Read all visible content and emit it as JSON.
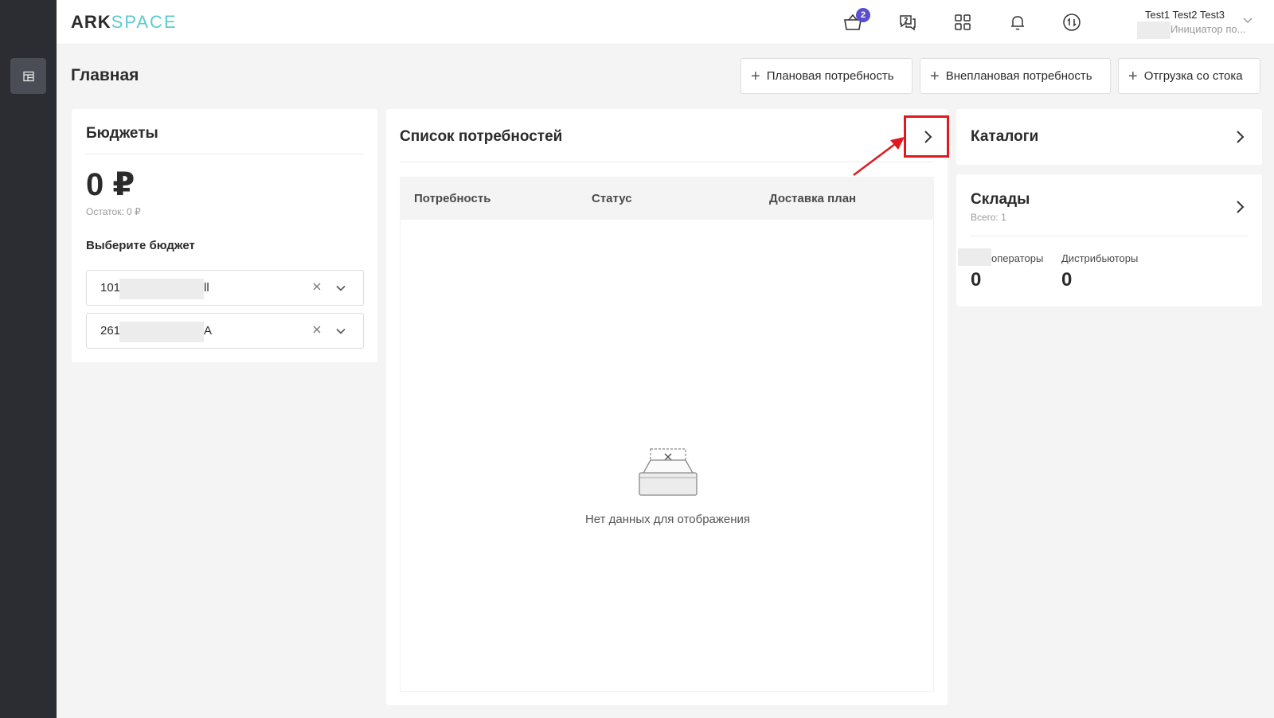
{
  "brand": {
    "logo_part1": "ARK",
    "logo_part2": "SPACE"
  },
  "header": {
    "cart_badge": "2",
    "user": {
      "name": "Test1 Test2 Test3",
      "role": "Инициатор по..."
    }
  },
  "page": {
    "title": "Главная"
  },
  "actions": [
    {
      "label": "Плановая потребность"
    },
    {
      "label": "Внеплановая потребность"
    },
    {
      "label": "Отгрузка со стока"
    }
  ],
  "budgets": {
    "title": "Бюджеты",
    "amount": "0 ₽",
    "rest": "Остаток: 0 ₽",
    "select_label": "Выберите бюджет",
    "selects": [
      {
        "prefix": "101",
        "suffix": "ll"
      },
      {
        "prefix": "261",
        "suffix": "A"
      }
    ]
  },
  "needs": {
    "title": "Список потребностей",
    "columns": [
      "Потребность",
      "Статус",
      "Доставка план"
    ],
    "empty_text": "Нет данных для отображения"
  },
  "catalogs": {
    "title": "Каталоги"
  },
  "warehouses": {
    "title": "Склады",
    "total": "Всего: 1",
    "stats": [
      {
        "label": "операторы",
        "value": "0"
      },
      {
        "label": "Дистрибьюторы",
        "value": "0"
      }
    ]
  },
  "colors": {
    "accent_badge": "#5b4fcf",
    "logo_space": "#5ccad0",
    "annotation": "#e0191e",
    "sidebar": "#2b2d33"
  }
}
